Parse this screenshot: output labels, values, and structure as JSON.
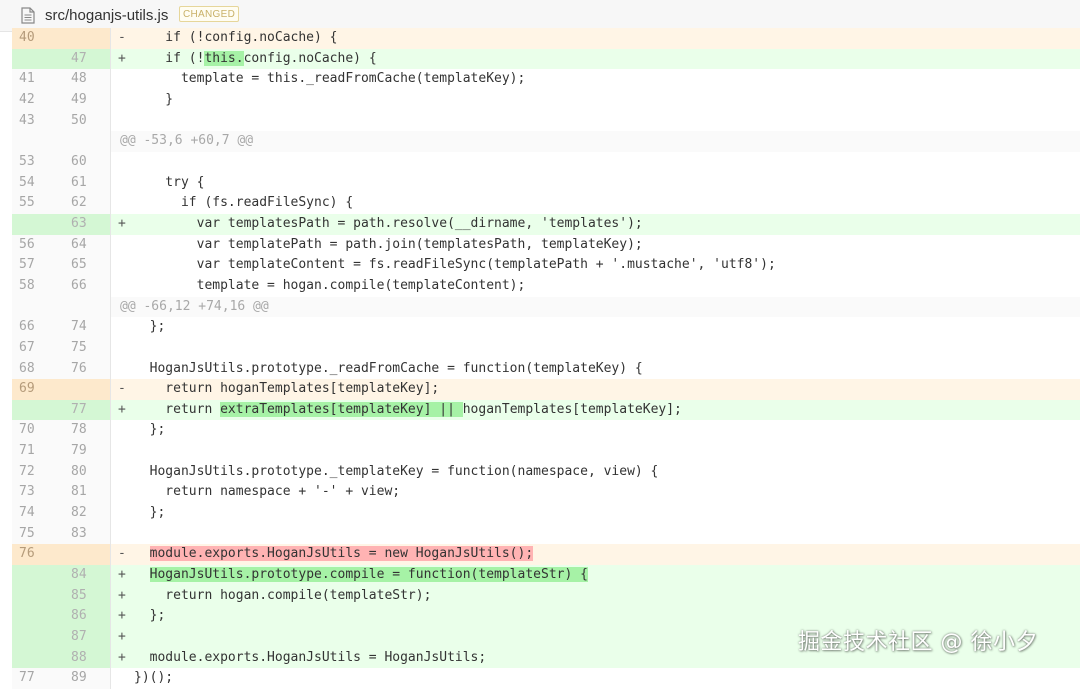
{
  "file": {
    "path": "src/hoganjs-utils.js",
    "status_badge": "CHANGED",
    "icon": "file-icon"
  },
  "diff_lines": [
    {
      "type": "del",
      "old": "40",
      "new": "",
      "sign": "-",
      "segments": [
        {
          "t": "    if (!config.noCache) {"
        }
      ]
    },
    {
      "type": "add",
      "old": "",
      "new": "47",
      "sign": "+",
      "segments": [
        {
          "t": "    if (!"
        },
        {
          "t": "this.",
          "hl": "add"
        },
        {
          "t": "config.noCache) {"
        }
      ]
    },
    {
      "type": "ctx",
      "old": "41",
      "new": "48",
      "sign": "",
      "segments": [
        {
          "t": "      template = this._readFromCache(templateKey);"
        }
      ]
    },
    {
      "type": "ctx",
      "old": "42",
      "new": "49",
      "sign": "",
      "segments": [
        {
          "t": "    }"
        }
      ]
    },
    {
      "type": "ctx",
      "old": "43",
      "new": "50",
      "sign": "",
      "segments": [
        {
          "t": ""
        }
      ]
    },
    {
      "type": "hunk",
      "old": "",
      "new": "",
      "sign": "",
      "segments": [
        {
          "t": "@@ -53,6 +60,7 @@"
        }
      ]
    },
    {
      "type": "ctx",
      "old": "53",
      "new": "60",
      "sign": "",
      "segments": [
        {
          "t": ""
        }
      ]
    },
    {
      "type": "ctx",
      "old": "54",
      "new": "61",
      "sign": "",
      "segments": [
        {
          "t": "    try {"
        }
      ]
    },
    {
      "type": "ctx",
      "old": "55",
      "new": "62",
      "sign": "",
      "segments": [
        {
          "t": "      if (fs.readFileSync) {"
        }
      ]
    },
    {
      "type": "add",
      "old": "",
      "new": "63",
      "sign": "+",
      "segments": [
        {
          "t": "        var templatesPath = path.resolve(__dirname, 'templates');"
        }
      ]
    },
    {
      "type": "ctx",
      "old": "56",
      "new": "64",
      "sign": "",
      "segments": [
        {
          "t": "        var templatePath = path.join(templatesPath, templateKey);"
        }
      ]
    },
    {
      "type": "ctx",
      "old": "57",
      "new": "65",
      "sign": "",
      "segments": [
        {
          "t": "        var templateContent = fs.readFileSync(templatePath + '.mustache', 'utf8');"
        }
      ]
    },
    {
      "type": "ctx",
      "old": "58",
      "new": "66",
      "sign": "",
      "segments": [
        {
          "t": "        template = hogan.compile(templateContent);"
        }
      ]
    },
    {
      "type": "hunk",
      "old": "",
      "new": "",
      "sign": "",
      "segments": [
        {
          "t": "@@ -66,12 +74,16 @@"
        }
      ]
    },
    {
      "type": "ctx",
      "old": "66",
      "new": "74",
      "sign": "",
      "segments": [
        {
          "t": "  };"
        }
      ]
    },
    {
      "type": "ctx",
      "old": "67",
      "new": "75",
      "sign": "",
      "segments": [
        {
          "t": ""
        }
      ]
    },
    {
      "type": "ctx",
      "old": "68",
      "new": "76",
      "sign": "",
      "segments": [
        {
          "t": "  HoganJsUtils.prototype._readFromCache = function(templateKey) {"
        }
      ]
    },
    {
      "type": "del",
      "old": "69",
      "new": "",
      "sign": "-",
      "segments": [
        {
          "t": "    return hoganTemplates[templateKey];"
        }
      ]
    },
    {
      "type": "add",
      "old": "",
      "new": "77",
      "sign": "+",
      "segments": [
        {
          "t": "    return "
        },
        {
          "t": "extraTemplates[templateKey] || ",
          "hl": "add"
        },
        {
          "t": "hoganTemplates[templateKey];"
        }
      ]
    },
    {
      "type": "ctx",
      "old": "70",
      "new": "78",
      "sign": "",
      "segments": [
        {
          "t": "  };"
        }
      ]
    },
    {
      "type": "ctx",
      "old": "71",
      "new": "79",
      "sign": "",
      "segments": [
        {
          "t": ""
        }
      ]
    },
    {
      "type": "ctx",
      "old": "72",
      "new": "80",
      "sign": "",
      "segments": [
        {
          "t": "  HoganJsUtils.prototype._templateKey = function(namespace, view) {"
        }
      ]
    },
    {
      "type": "ctx",
      "old": "73",
      "new": "81",
      "sign": "",
      "segments": [
        {
          "t": "    return namespace + '-' + view;"
        }
      ]
    },
    {
      "type": "ctx",
      "old": "74",
      "new": "82",
      "sign": "",
      "segments": [
        {
          "t": "  };"
        }
      ]
    },
    {
      "type": "ctx",
      "old": "75",
      "new": "83",
      "sign": "",
      "segments": [
        {
          "t": ""
        }
      ]
    },
    {
      "type": "del",
      "old": "76",
      "new": "",
      "sign": "-",
      "segments": [
        {
          "t": "  "
        },
        {
          "t": "module.exports.HoganJsUtils = new HoganJsUtils();",
          "hl": "del"
        }
      ]
    },
    {
      "type": "add",
      "old": "",
      "new": "84",
      "sign": "+",
      "segments": [
        {
          "t": "  "
        },
        {
          "t": "HoganJsUtils.prototype.compile = function(templateStr) {",
          "hl": "add"
        }
      ]
    },
    {
      "type": "add",
      "old": "",
      "new": "85",
      "sign": "+",
      "segments": [
        {
          "t": "    return hogan.compile(templateStr);"
        }
      ]
    },
    {
      "type": "add",
      "old": "",
      "new": "86",
      "sign": "+",
      "segments": [
        {
          "t": "  };"
        }
      ]
    },
    {
      "type": "add",
      "old": "",
      "new": "87",
      "sign": "+",
      "segments": [
        {
          "t": ""
        }
      ]
    },
    {
      "type": "add",
      "old": "",
      "new": "88",
      "sign": "+",
      "segments": [
        {
          "t": "  module.exports.HoganJsUtils = HoganJsUtils;"
        }
      ]
    },
    {
      "type": "ctx",
      "old": "77",
      "new": "89",
      "sign": "",
      "segments": [
        {
          "t": "})();"
        }
      ]
    }
  ],
  "watermark": "掘金技术社区 @ 徐小夕",
  "colors": {
    "added_bg": "#eaffea",
    "added_highlight": "#a6f2a6",
    "deleted_bg": "#fff5e6",
    "deleted_highlight": "#ffb3b3"
  }
}
